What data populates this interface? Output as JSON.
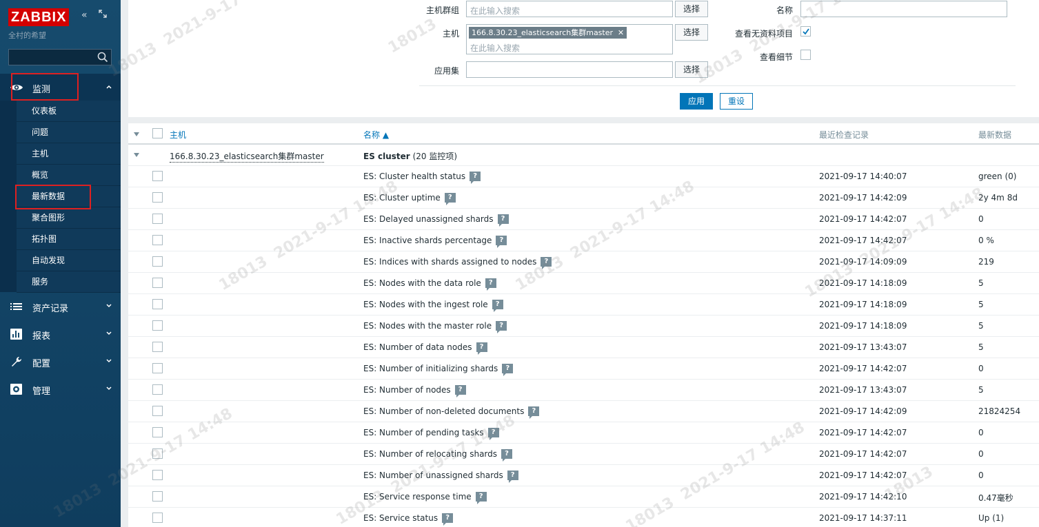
{
  "sidebar": {
    "logo": "ZABBIX",
    "subtitle": "全村的希望",
    "sections": [
      {
        "label": "监测",
        "icon": "eye-icon",
        "expanded": true
      },
      {
        "label": "资产记录",
        "icon": "list-icon"
      },
      {
        "label": "报表",
        "icon": "chart-icon"
      },
      {
        "label": "配置",
        "icon": "wrench-icon"
      },
      {
        "label": "管理",
        "icon": "gear-icon"
      }
    ],
    "monitoring_items": [
      "仪表板",
      "问题",
      "主机",
      "概览",
      "最新数据",
      "聚合图形",
      "拓扑图",
      "自动发现",
      "服务"
    ]
  },
  "filter": {
    "host_group_label": "主机群组",
    "host_label": "主机",
    "app_label": "应用集",
    "name_label": "名称",
    "show_no_data_label": "查看无资料项目",
    "show_details_label": "查看细节",
    "search_placeholder": "在此输入搜索",
    "host_chip": "166.8.30.23_elasticsearch集群master",
    "select_label": "选择",
    "apply_label": "应用",
    "reset_label": "重设",
    "show_no_data_checked": true,
    "show_details_checked": false
  },
  "table": {
    "headers": {
      "host": "主机",
      "name": "名称 ▲",
      "last_check": "最近检查记录",
      "last_value": "最新数据"
    },
    "group_host": "166.8.30.23_elasticsearch集群master",
    "group_app": "ES cluster",
    "group_count": "(20 监控项)",
    "rows": [
      {
        "name": "ES: Cluster health status",
        "time": "2021-09-17 14:40:07",
        "value": "green (0)"
      },
      {
        "name": "ES: Cluster uptime",
        "time": "2021-09-17 14:42:09",
        "value": "2y 4m 8d"
      },
      {
        "name": "ES: Delayed unassigned shards",
        "time": "2021-09-17 14:42:07",
        "value": "0"
      },
      {
        "name": "ES: Inactive shards percentage",
        "time": "2021-09-17 14:42:07",
        "value": "0 %"
      },
      {
        "name": "ES: Indices with shards assigned to nodes",
        "time": "2021-09-17 14:09:09",
        "value": "219"
      },
      {
        "name": "ES: Nodes with the data role",
        "time": "2021-09-17 14:18:09",
        "value": "5"
      },
      {
        "name": "ES: Nodes with the ingest role",
        "time": "2021-09-17 14:18:09",
        "value": "5"
      },
      {
        "name": "ES: Nodes with the master role",
        "time": "2021-09-17 14:18:09",
        "value": "5"
      },
      {
        "name": "ES: Number of data nodes",
        "time": "2021-09-17 13:43:07",
        "value": "5"
      },
      {
        "name": "ES: Number of initializing shards",
        "time": "2021-09-17 14:42:07",
        "value": "0"
      },
      {
        "name": "ES: Number of nodes",
        "time": "2021-09-17 13:43:07",
        "value": "5"
      },
      {
        "name": "ES: Number of non-deleted documents",
        "time": "2021-09-17 14:42:09",
        "value": "21824254"
      },
      {
        "name": "ES: Number of pending tasks",
        "time": "2021-09-17 14:42:07",
        "value": "0"
      },
      {
        "name": "ES: Number of relocating shards",
        "time": "2021-09-17 14:42:07",
        "value": "0"
      },
      {
        "name": "ES: Number of unassigned shards",
        "time": "2021-09-17 14:42:07",
        "value": "0"
      },
      {
        "name": "ES: Service response time",
        "time": "2021-09-17 14:42:10",
        "value": "0.47毫秒"
      },
      {
        "name": "ES: Service status",
        "time": "2021-09-17 14:37:11",
        "value": "Up (1)"
      }
    ]
  },
  "watermark": {
    "id": "18013",
    "date": "2021-9-17 14:48"
  },
  "colors": {
    "accent": "#0275b8",
    "sidebar": "#164b6d",
    "logo": "#d40000",
    "highlight": "#e02020"
  }
}
